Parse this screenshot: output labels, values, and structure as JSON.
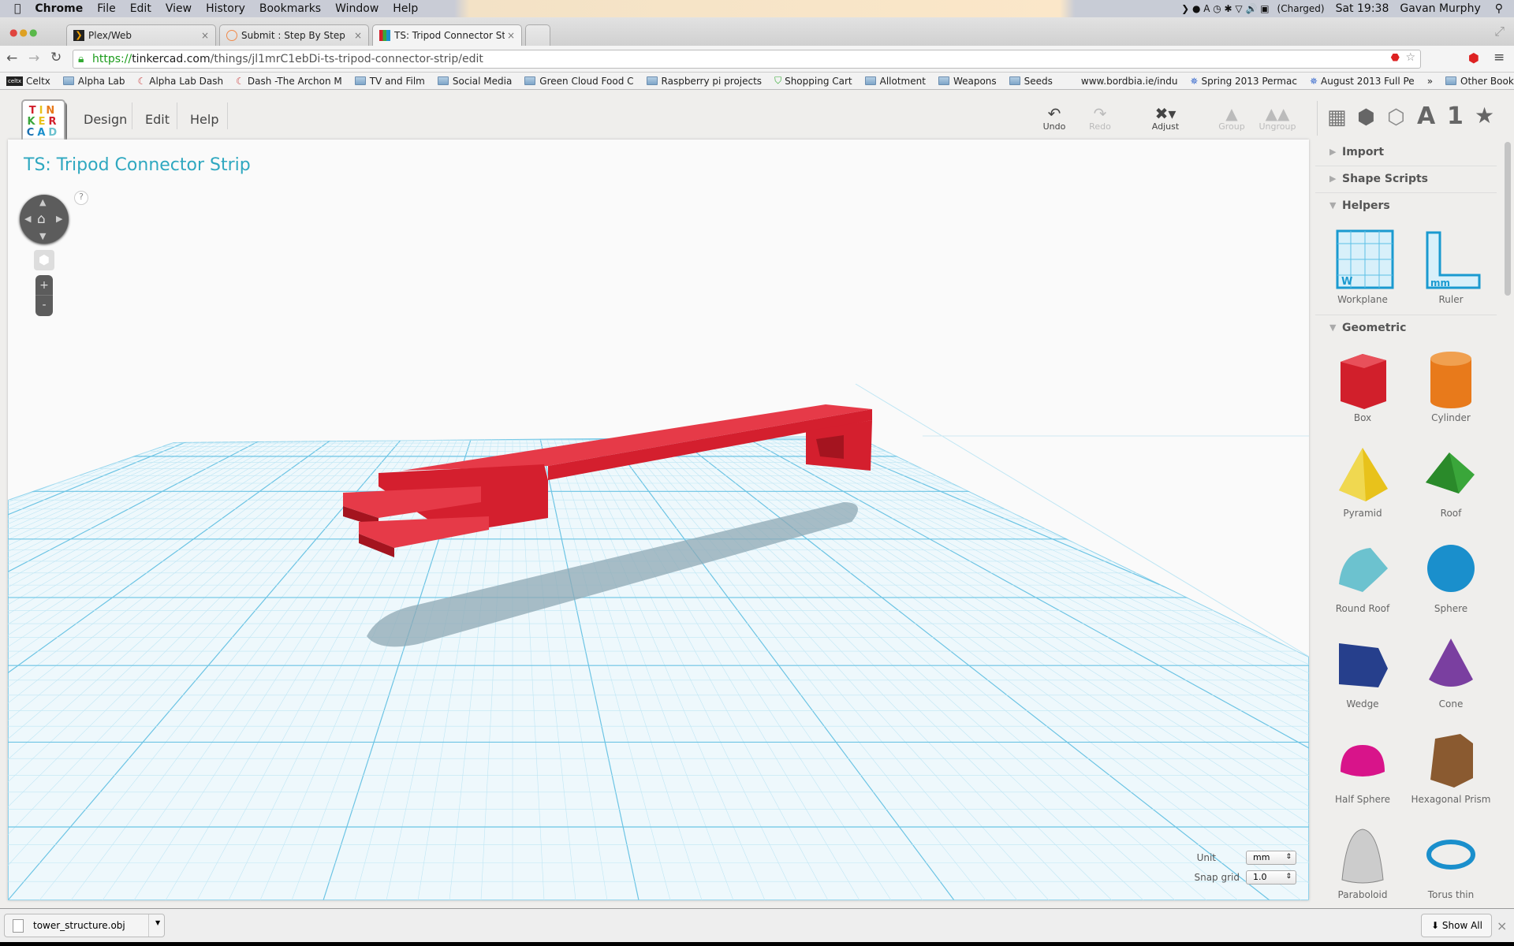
{
  "menubar": {
    "app": "Chrome",
    "items": [
      "File",
      "Edit",
      "View",
      "History",
      "Bookmarks",
      "Window",
      "Help"
    ],
    "battery": "(Charged)",
    "clock": "Sat 19:38",
    "user": "Gavan Murphy"
  },
  "tabs": [
    {
      "label": "Plex/Web"
    },
    {
      "label": "Submit : Step By Step"
    },
    {
      "label": "TS: Tripod Connector Strip",
      "active": true
    }
  ],
  "address": {
    "scheme": "https://",
    "domain": "tinkercad.com",
    "path": "/things/jl1mrC1ebDi-ts-tripod-connector-strip/edit"
  },
  "bookmarks": [
    "Celtx",
    "Alpha Lab",
    "Alpha Lab Dash",
    "Dash -The Archon M",
    "TV and Film",
    "Social Media",
    "Green Cloud Food C",
    "Raspberry pi projects",
    "Shopping Cart",
    "Allotment",
    "Weapons",
    "Seeds",
    "www.bordbia.ie/indu",
    "Spring 2013 Permac",
    "August 2013 Full Pe",
    "»",
    "Other Bookmarks"
  ],
  "app": {
    "logo": "TIN KER CAD",
    "nav": [
      "Design",
      "Edit",
      "Help"
    ],
    "toolbar": {
      "undo": "Undo",
      "redo": "Redo",
      "adjust": "Adjust",
      "group": "Group",
      "ungroup": "Ungroup"
    },
    "view_icons": [
      "grid-icon",
      "box-icon",
      "striped-box-icon",
      "A",
      "1",
      "star-icon"
    ],
    "design_title": "TS: Tripod Connector Strip",
    "help": "?",
    "zoom_in": "+",
    "zoom_out": "-",
    "unit_label": "Unit",
    "unit_value": "mm",
    "snap_label": "Snap grid",
    "snap_value": "1.0"
  },
  "panel": {
    "sections": [
      "Import",
      "Shape Scripts",
      "Helpers",
      "Geometric"
    ],
    "helpers": [
      "Workplane",
      "Ruler"
    ],
    "geometric": [
      {
        "name": "Box",
        "color": "#d11f2b"
      },
      {
        "name": "Cylinder",
        "color": "#e87a1b"
      },
      {
        "name": "Pyramid",
        "color": "#e8c21b"
      },
      {
        "name": "Roof",
        "color": "#3aa63a"
      },
      {
        "name": "Round Roof",
        "color": "#6cc2cf"
      },
      {
        "name": "Sphere",
        "color": "#1a8fcc"
      },
      {
        "name": "Wedge",
        "color": "#263f8c"
      },
      {
        "name": "Cone",
        "color": "#7a3fa0"
      },
      {
        "name": "Half Sphere",
        "color": "#d8148a"
      },
      {
        "name": "Hexagonal Prism",
        "color": "#8a5a30"
      },
      {
        "name": "Paraboloid",
        "color": "#cccccc"
      },
      {
        "name": "Torus thin",
        "color": "#1a8fcc"
      }
    ]
  },
  "download": {
    "file": "tower_structure.obj",
    "show_all": "Show All"
  }
}
